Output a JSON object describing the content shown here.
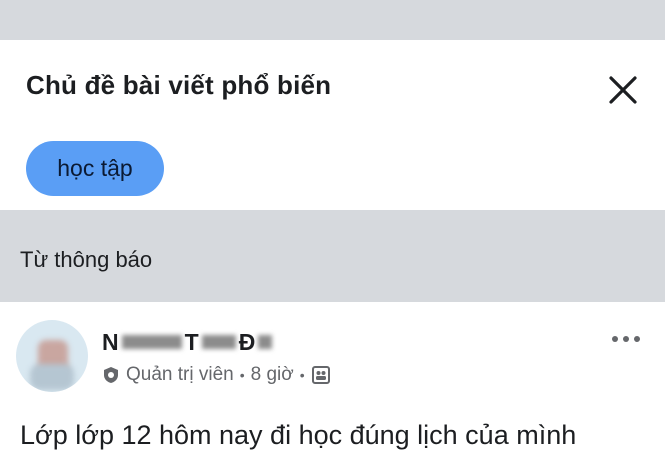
{
  "topics": {
    "title": "Chủ đề bài viết phổ biến",
    "close_icon": "close-icon",
    "chips": [
      "học tập"
    ],
    "chip_color": "#5a9ef5"
  },
  "announcements": {
    "label": "Từ thông báo"
  },
  "post": {
    "author": {
      "first_initial": "N",
      "middle_initial": "T",
      "last_initial": "Đ"
    },
    "role": "Quản trị viên",
    "time": "8 giờ",
    "separator": "•",
    "audience_icon": "group-icon",
    "more_icon": "more-dots-icon",
    "text": "Lớp lớp 12 hôm nay đi học đúng lịch của mình"
  },
  "colors": {
    "band_gray": "#d6d9dd",
    "text_primary": "#1c1e21",
    "text_secondary": "#65676b"
  }
}
